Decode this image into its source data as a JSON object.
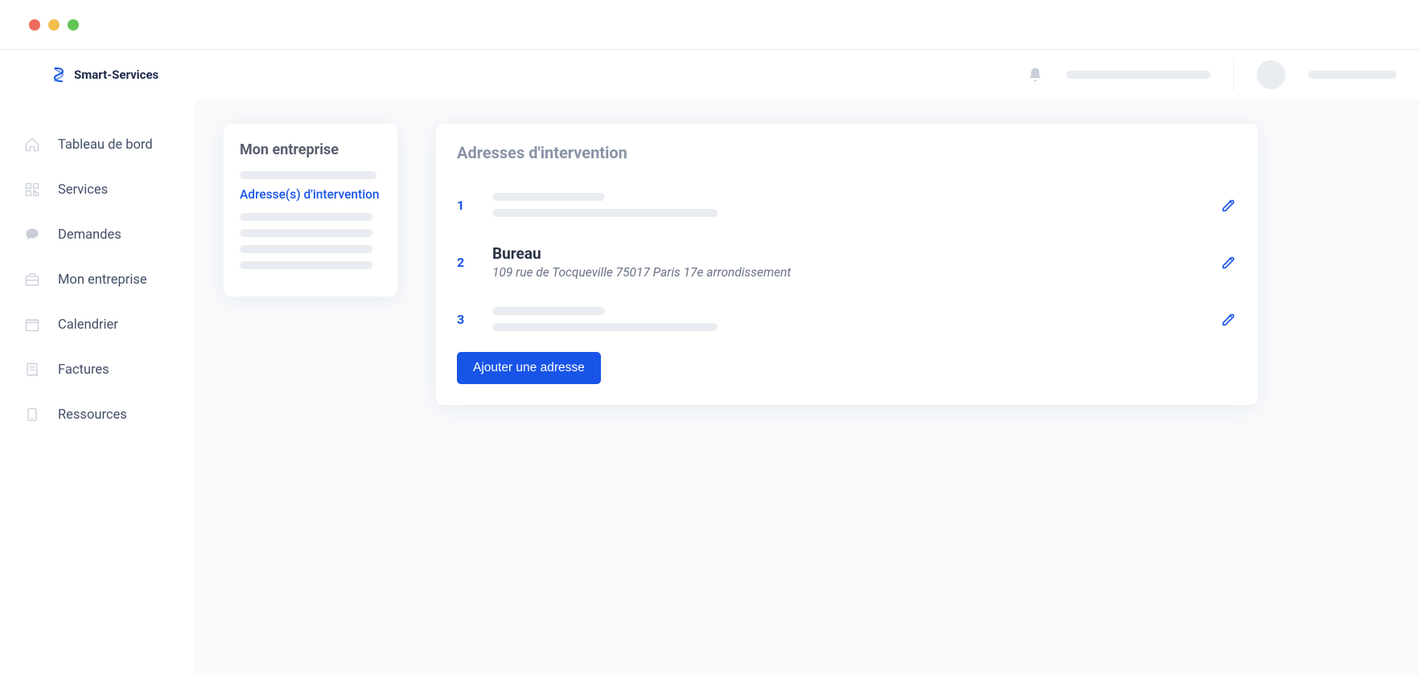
{
  "brand": {
    "name": "Smart-Services"
  },
  "sidebar": {
    "items": [
      {
        "label": "Tableau de bord",
        "icon": "home-icon"
      },
      {
        "label": "Services",
        "icon": "qr-icon"
      },
      {
        "label": "Demandes",
        "icon": "chat-icon"
      },
      {
        "label": "Mon entreprise",
        "icon": "briefcase-icon"
      },
      {
        "label": "Calendrier",
        "icon": "calendar-icon"
      },
      {
        "label": "Factures",
        "icon": "receipt-icon"
      },
      {
        "label": "Ressources",
        "icon": "device-icon"
      }
    ]
  },
  "side_card": {
    "title": "Mon entreprise",
    "active_item": "Adresse(s) d'intervention"
  },
  "main": {
    "title": "Adresses d'intervention",
    "addresses": [
      {
        "num": "1",
        "name": "",
        "detail": ""
      },
      {
        "num": "2",
        "name": "Bureau",
        "detail": "109 rue de Tocqueville 75017 Paris 17e arrondissement"
      },
      {
        "num": "3",
        "name": "",
        "detail": ""
      }
    ],
    "add_button": "Ajouter une adresse"
  }
}
